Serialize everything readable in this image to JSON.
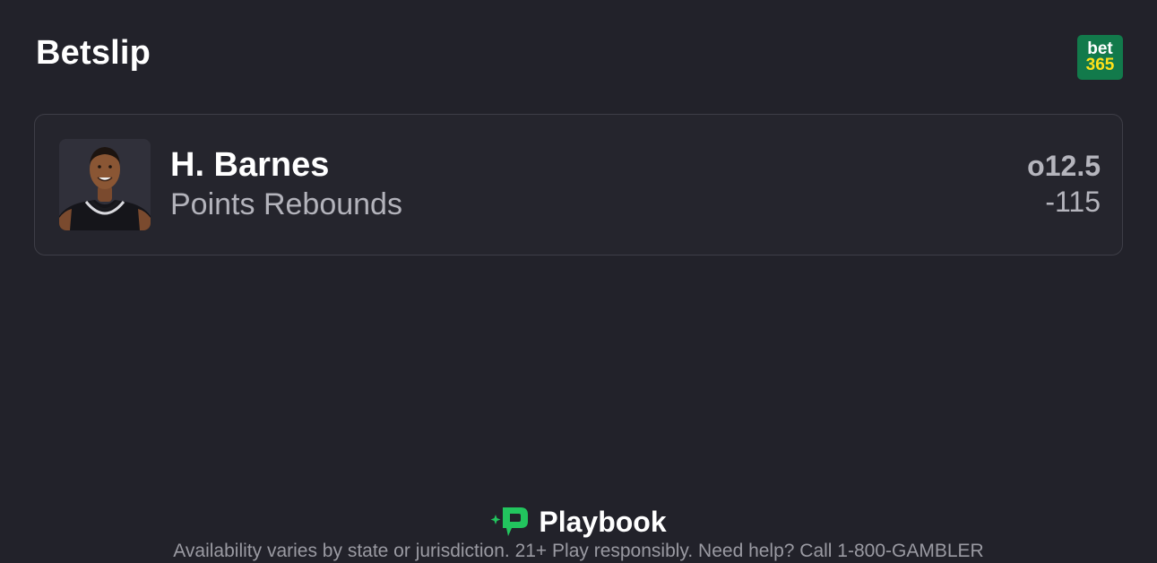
{
  "header": {
    "title": "Betslip",
    "sportsbook_logo": {
      "line1": "bet",
      "line2": "365",
      "bg_color": "#127a4b",
      "accent_color": "#ffe11a"
    }
  },
  "bet": {
    "player_name": "H. Barnes",
    "market": "Points Rebounds",
    "line": "o12.5",
    "odds": "-115",
    "avatar_icon": "player-headshot"
  },
  "footer": {
    "brand_name": "Playbook",
    "brand_icon": "playbook-logo-icon",
    "brand_color": "#22c55e",
    "disclaimer": "Availability varies by state or jurisdiction. 21+ Play responsibly. Need help? Call 1-800-GAMBLER"
  }
}
